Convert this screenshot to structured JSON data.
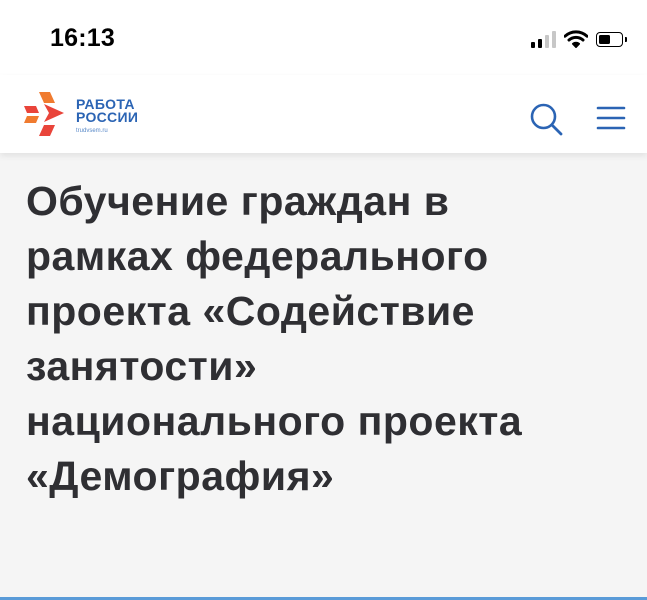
{
  "status_bar": {
    "time": "16:13"
  },
  "header": {
    "logo": {
      "line1": "РАБОТА",
      "line2": "РОССИИ",
      "domain": "trudvsem.ru"
    },
    "search_icon": "search-icon",
    "menu_icon": "hamburger-menu-icon"
  },
  "page": {
    "title_lines": [
      "Обучение граждан в",
      "рамках федерального",
      "проекта «Содействие",
      "занятости»",
      "национального проекта",
      "«Демография»"
    ]
  },
  "colors": {
    "brand_blue": "#2b64b4",
    "logo_red": "#e9443a",
    "logo_orange": "#f07b2f",
    "title_text": "#2f2f33",
    "page_background": "#f5f5f5",
    "accent_strip": "#5a9bd8"
  }
}
